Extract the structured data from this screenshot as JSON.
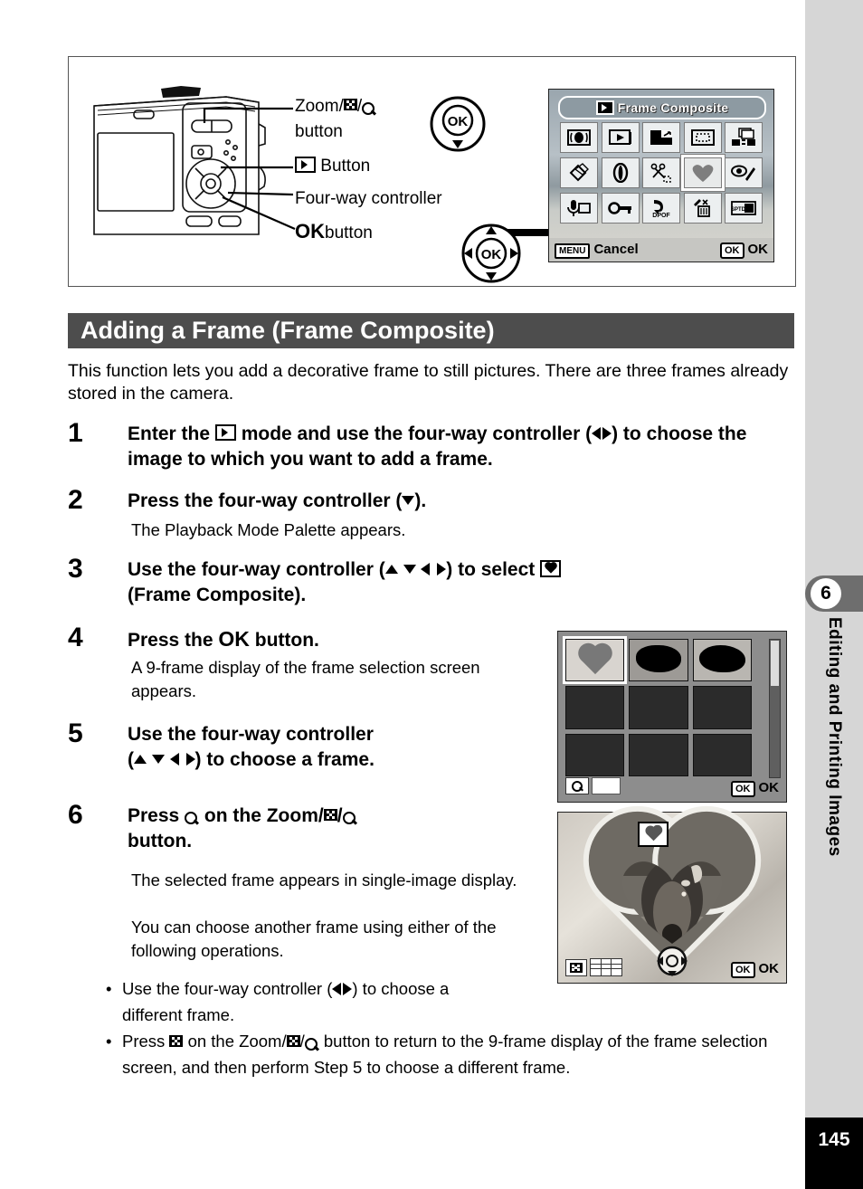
{
  "figure": {
    "callouts": [
      {
        "id": "zoom",
        "label": "Zoom/",
        "label2": "/",
        "label3": "button",
        "icon_nine": "nine-frame-icon",
        "icon_mag": "magnify-icon"
      },
      {
        "id": "playback",
        "label": "Button",
        "icon": "playback-icon"
      },
      {
        "id": "fourway",
        "label": "Four-way controller"
      },
      {
        "id": "ok",
        "label_bold": "OK",
        "label": " button"
      }
    ],
    "zoom_label_line1": "Zoom/",
    "zoom_label_line2": "button",
    "playback_button_label": "Button",
    "fourway_label": "Four-way controller",
    "ok_label_bold": "OK",
    "ok_label_rest": "button"
  },
  "lcd": {
    "title": "Frame Composite",
    "cancel_key": "MENU",
    "cancel_label": "Cancel",
    "ok_key": "OK",
    "ok_label": "OK",
    "icons_row1": [
      "slideshow-icon",
      "playback-icon",
      "resize-icon",
      "cropping-icon",
      "image-copy-icon"
    ],
    "icons_row2": [
      "digital-filter-icon",
      "red-eye-icon",
      "crop-scissors-icon",
      "frame-composite-heart-icon",
      "red-eye-pen-icon"
    ],
    "icons_row3": [
      "voice-memo-icon",
      "protect-key-icon",
      "dpof-icon",
      "delete-icon",
      "start-up-screen-icon"
    ],
    "dpof_text": "DPOF",
    "startup_text": "SPTD",
    "selected_icon": "frame-composite-heart-icon"
  },
  "heading": "Adding a Frame (Frame Composite)",
  "intro": "This function lets you add a decorative frame to still pictures. There are three frames already stored in the camera.",
  "steps": [
    {
      "num": "1",
      "title_a": "Enter the",
      "title_b": "mode and use the four-way controller (",
      "title_c": ") to choose the image to which you want to add a frame."
    },
    {
      "num": "2",
      "title_a": "Press the four-way controller (",
      "title_c": ").",
      "body": "The Playback Mode Palette appears."
    },
    {
      "num": "3",
      "title_a": "Use the four-way controller (",
      "title_b": ") to select",
      "title_c": "(Frame Composite)."
    },
    {
      "num": "4",
      "title_a": "Press the",
      "title_bold": "OK",
      "title_c": "button.",
      "body": "A 9-frame display of the frame selection screen appears."
    },
    {
      "num": "5",
      "title_a": "Use the four-way controller",
      "title_c": ") to choose a frame."
    },
    {
      "num": "6",
      "title_a": "Press",
      "title_b": "on the Zoom/",
      "title_c": "button.",
      "body1": "The selected frame appears in single-image display.",
      "body2": "You can choose another frame using either of the following operations."
    }
  ],
  "bullets": [
    {
      "a": "Use the four-way controller (",
      "b": ") to choose a different frame."
    },
    {
      "a": "Press",
      "b": "on the Zoom/",
      "c": "button to return to the 9-frame display of the frame selection screen, and then perform Step 5 to choose a different frame."
    }
  ],
  "sidebar": {
    "chapter_number": "6",
    "chapter_title": "Editing and Printing Images",
    "page_number": "145"
  },
  "colors": {
    "heading_bar": "#4d4d4d",
    "sidebar": "#d6d6d6",
    "chapter_tab": "#6e6e6e",
    "page_box": "#000000"
  }
}
